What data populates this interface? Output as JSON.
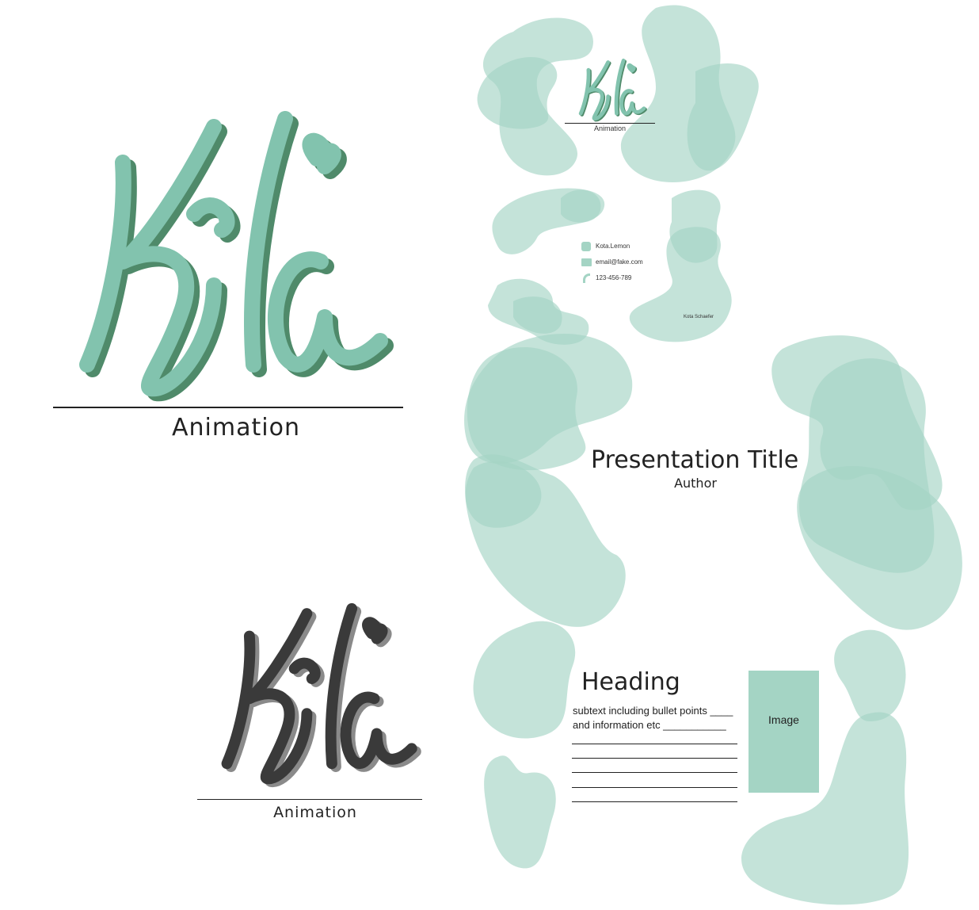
{
  "brand": {
    "logo_text": "Kota",
    "caption": "Animation",
    "accent_color": "#82c3ae",
    "shadow_color": "#4f8a6a",
    "blob_color": "#a4d4c4",
    "dark_color": "#3a3a3a",
    "dark_shadow": "#8a8a8a"
  },
  "card": {
    "caption": "Animation",
    "contacts": [
      {
        "icon": "instagram-icon",
        "text": "Kota.Lemon"
      },
      {
        "icon": "mail-icon",
        "text": "email@fake.com"
      },
      {
        "icon": "phone-icon",
        "text": "123-456-789"
      }
    ],
    "name": "Kota Schaefer"
  },
  "title_slide": {
    "title": "Presentation Title",
    "author": "Author"
  },
  "content_slide": {
    "heading": "Heading",
    "subtext_line1": "subtext including bullet points ____",
    "subtext_line2": "and information etc ___________",
    "image_label": "Image"
  },
  "dark_logo": {
    "caption": "Animation"
  }
}
